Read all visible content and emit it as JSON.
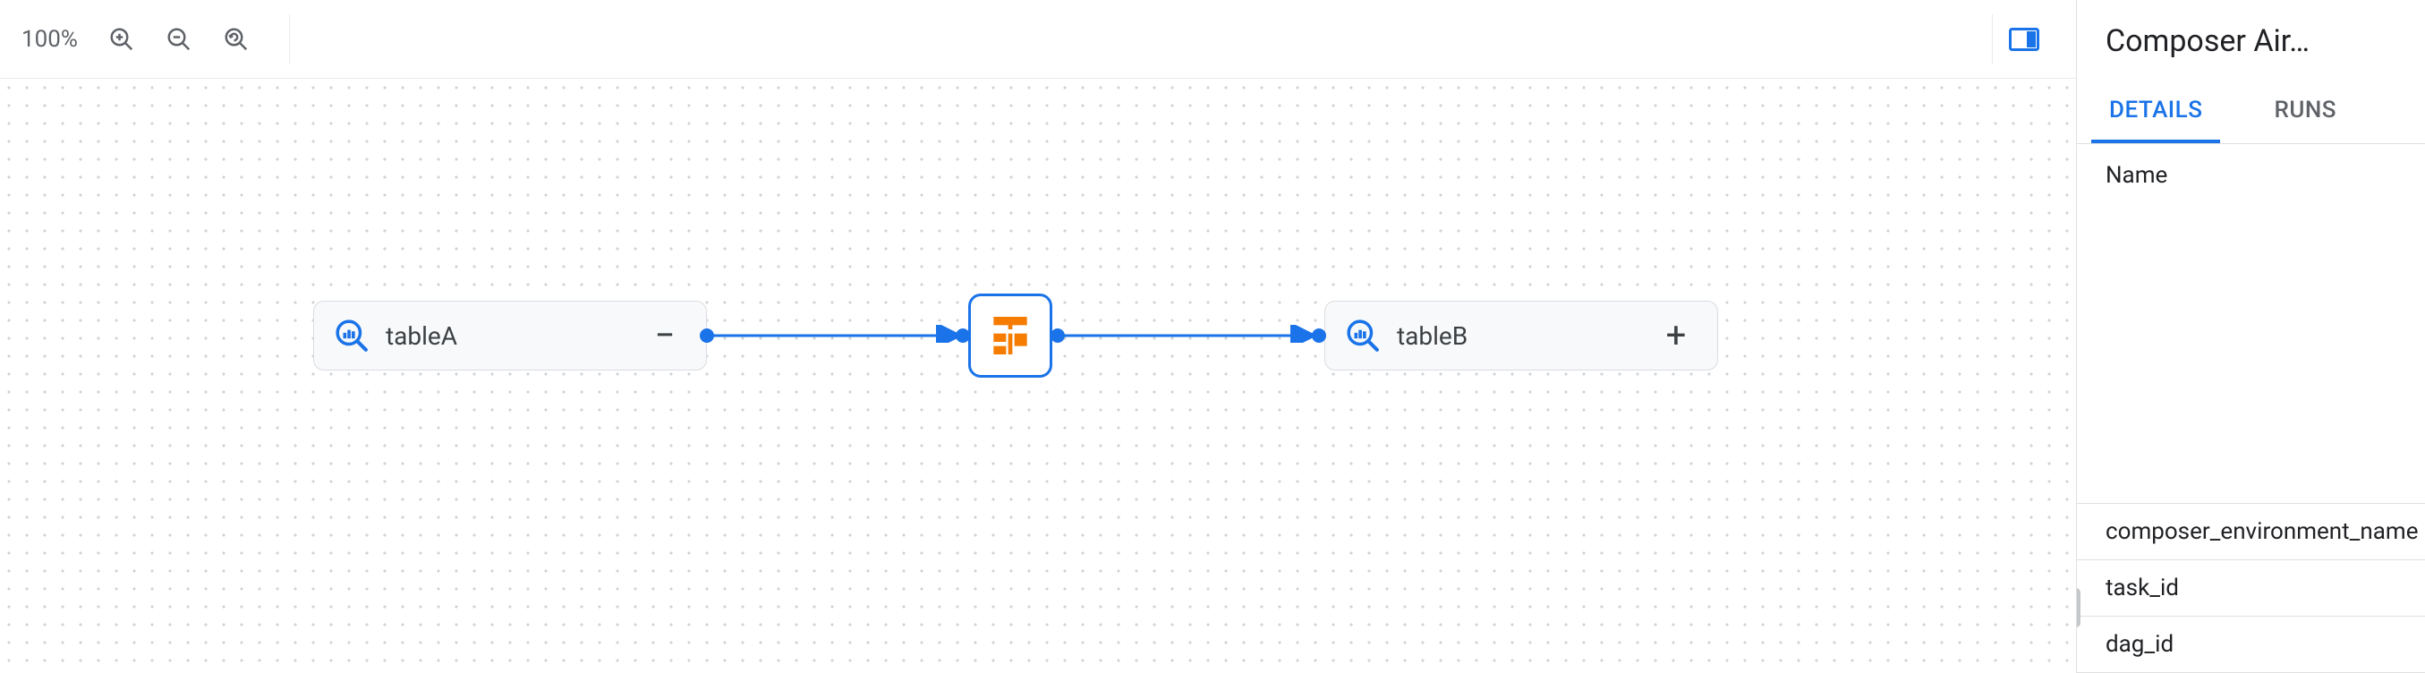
{
  "toolbar": {
    "zoom": "100%"
  },
  "nodes": {
    "left": {
      "label": "tableA",
      "action": "−"
    },
    "right": {
      "label": "tableB",
      "action": "+"
    }
  },
  "sidebar": {
    "title": "Composer Air…",
    "tabs": {
      "details": "Details",
      "runs": "Runs"
    },
    "name_label": "Name",
    "props": {
      "env": "composer_environment_name",
      "task": "task_id",
      "dag": "dag_id"
    }
  }
}
